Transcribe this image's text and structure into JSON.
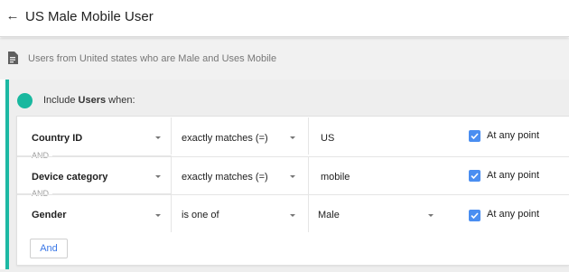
{
  "header": {
    "back_icon": "arrow-left-icon",
    "title": "US Male Mobile User"
  },
  "description": {
    "icon": "document-icon",
    "text": "Users from United states who are Male and Uses Mobile"
  },
  "group": {
    "accent_color": "#1db9a4",
    "include_prefix": "Include ",
    "include_bold": "Users",
    "include_suffix": " when:"
  },
  "conditions": [
    {
      "dimension": "Country ID",
      "operator": "exactly matches (=)",
      "value": "US",
      "value_has_dropdown": false,
      "any_point_checked": true,
      "any_point_label": "At any point"
    },
    {
      "dimension": "Device category",
      "operator": "exactly matches (=)",
      "value": "mobile",
      "value_has_dropdown": false,
      "any_point_checked": true,
      "any_point_label": "At any point"
    },
    {
      "dimension": "Gender",
      "operator": "is one of",
      "value": "Male",
      "value_has_dropdown": true,
      "any_point_checked": true,
      "any_point_label": "At any point"
    }
  ],
  "separators": [
    "AND",
    "AND"
  ],
  "and_button_label": "And",
  "colors": {
    "checkbox": "#4a8ef1",
    "link_blue": "#3b78e7"
  }
}
